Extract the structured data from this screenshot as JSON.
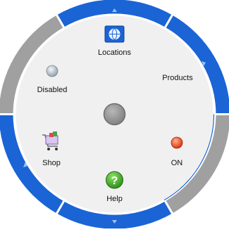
{
  "colors": {
    "accent": "#1a64d6",
    "inactive": "#a0a0a0",
    "center": "#f0f0f0",
    "hub": "#9a9a9a",
    "status_on": "#e8401a"
  },
  "items": [
    {
      "id": "locations",
      "label": "Locations",
      "icon": "globe-icon",
      "active": true
    },
    {
      "id": "products",
      "label": "Products",
      "icon": null,
      "active": true
    },
    {
      "id": "on",
      "label": "ON",
      "icon": "red-status-dot-icon",
      "active": false
    },
    {
      "id": "help",
      "label": "Help",
      "icon": "help-question-icon",
      "active": true
    },
    {
      "id": "shop",
      "label": "Shop",
      "icon": "shopping-cart-icon",
      "active": true
    },
    {
      "id": "disabled",
      "label": "Disabled",
      "icon": "gray-status-dot-icon",
      "active": false
    }
  ]
}
